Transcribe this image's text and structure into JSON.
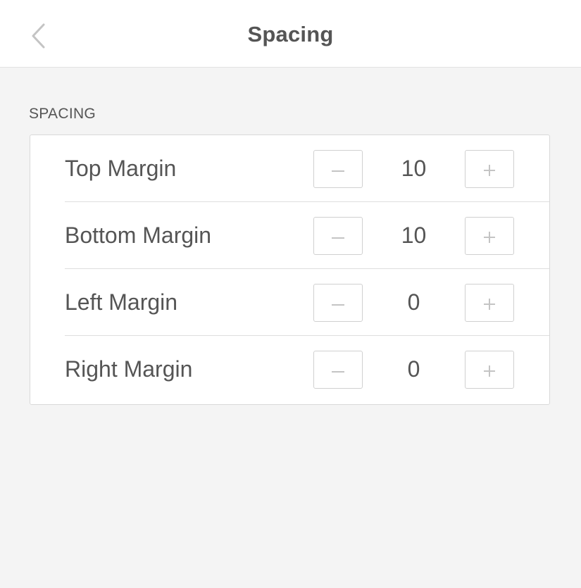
{
  "header": {
    "title": "Spacing",
    "back_icon": "chevron-left-icon"
  },
  "section": {
    "label": "SPACING"
  },
  "rows": [
    {
      "label": "Top Margin",
      "value": "10",
      "decrement_icon": "minus-icon",
      "increment_icon": "plus-icon"
    },
    {
      "label": "Bottom Margin",
      "value": "10",
      "decrement_icon": "minus-icon",
      "increment_icon": "plus-icon"
    },
    {
      "label": "Left Margin",
      "value": "0",
      "decrement_icon": "minus-icon",
      "increment_icon": "plus-icon"
    },
    {
      "label": "Right Margin",
      "value": "0",
      "decrement_icon": "minus-icon",
      "increment_icon": "plus-icon"
    }
  ],
  "colors": {
    "background": "#f4f4f4",
    "panel": "#ffffff",
    "text": "#555555",
    "border": "#d9d9d9",
    "icon": "#c4c4c4"
  }
}
